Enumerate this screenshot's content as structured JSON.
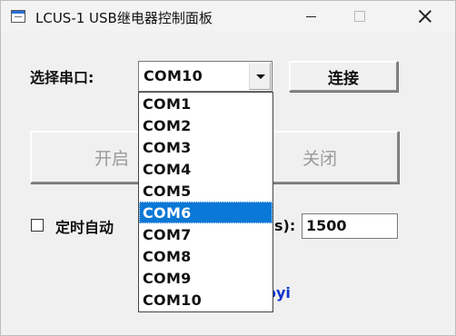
{
  "window": {
    "title": "LCUS-1 USB继电器控制面板"
  },
  "port": {
    "label": "选择串口:",
    "selected": "COM10",
    "options": [
      "COM1",
      "COM2",
      "COM3",
      "COM4",
      "COM5",
      "COM6",
      "COM7",
      "COM8",
      "COM9",
      "COM10"
    ],
    "highlighted": "COM6"
  },
  "buttons": {
    "connect": "连接",
    "open": "开启",
    "close": "关闭"
  },
  "timer": {
    "label": "定时自动",
    "unit_suffix": "s):",
    "interval_value": "1500",
    "checked": false
  },
  "credit": {
    "text_visible": "oyi"
  },
  "colors": {
    "highlight": "#0a78d6",
    "credit": "#1034cc",
    "disabled_text": "#9a9a9a"
  }
}
